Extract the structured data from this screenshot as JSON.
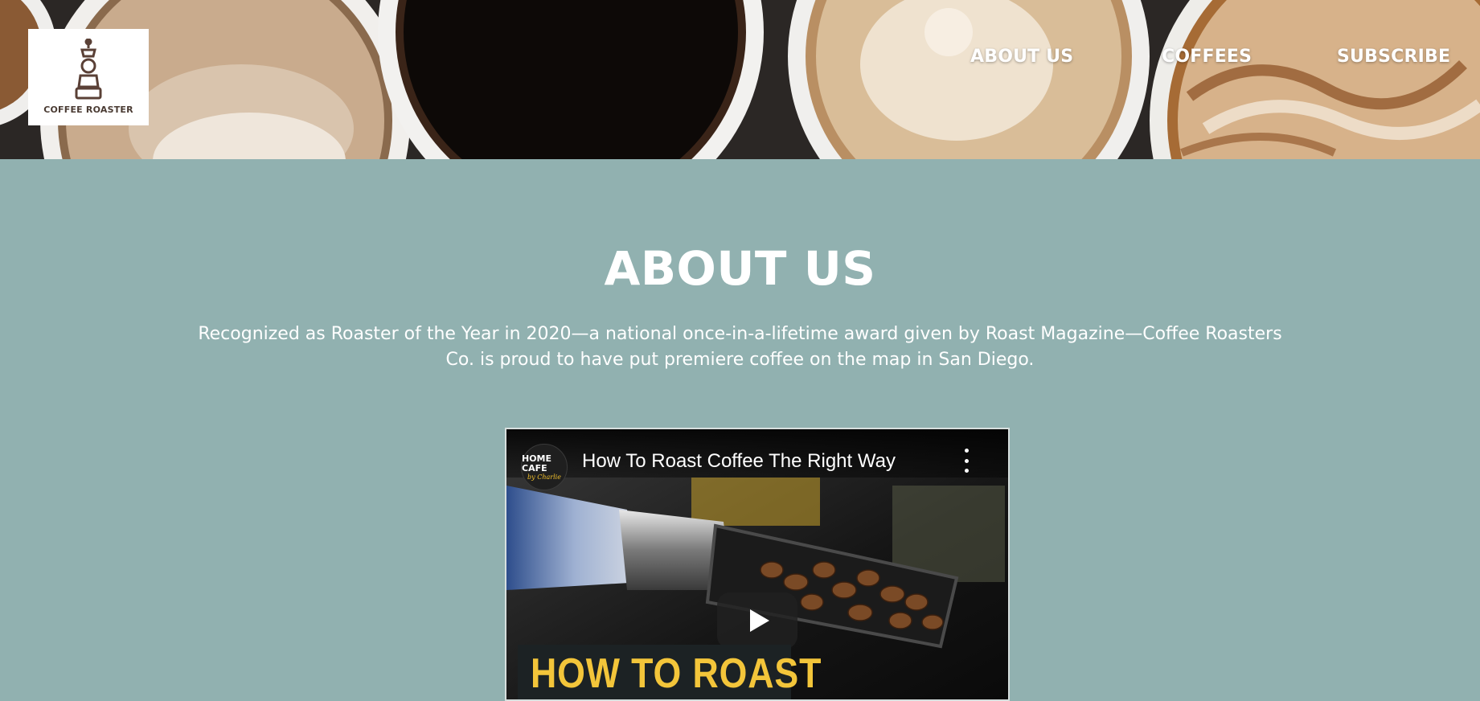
{
  "header": {
    "logo_text": "COFFEE ROASTER",
    "nav": [
      {
        "label": "ABOUT US"
      },
      {
        "label": "COFFEES"
      },
      {
        "label": "SUBSCRIBE"
      }
    ]
  },
  "about": {
    "title": "ABOUT US",
    "text": "Recognized as Roaster of the Year in 2020—a national once-in-a-lifetime award given by Roast Magazine—Coffee Roasters Co. is proud to have put premiere coffee on the map in San Diego."
  },
  "video": {
    "channel_line1": "HOME CAFE",
    "channel_line2": "by Charlie",
    "title": "How To Roast Coffee The Right Way",
    "thumbnail_text": "HOW TO ROAST",
    "icons": [
      "more-vert-icon",
      "play-icon"
    ]
  },
  "colors": {
    "page_background": "#91b1b0",
    "text": "#ffffff",
    "thumbnail_accent": "#f3c53a"
  }
}
